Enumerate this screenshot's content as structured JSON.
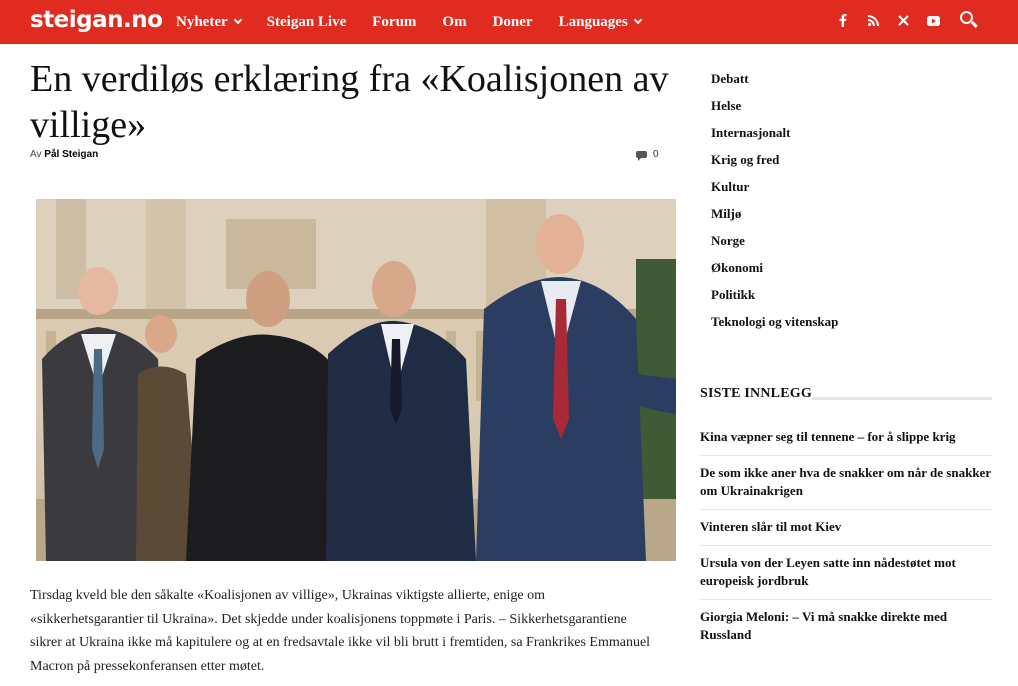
{
  "header": {
    "logo": "steigan.no",
    "nav": [
      {
        "label": "Nyheter",
        "dropdown": true
      },
      {
        "label": "Steigan Live",
        "dropdown": false
      },
      {
        "label": "Forum",
        "dropdown": false
      },
      {
        "label": "Om",
        "dropdown": false
      },
      {
        "label": "Doner",
        "dropdown": false
      },
      {
        "label": "Languages",
        "dropdown": true
      }
    ],
    "social_icons": [
      "facebook-icon",
      "rss-icon",
      "x-icon",
      "youtube-icon"
    ],
    "search_icon": "search-icon",
    "brand_color": "#e02b20"
  },
  "article": {
    "title": "En verdiløs erklæring fra «Koalisjonen av villige»",
    "byline_prefix": "Av",
    "author": "Pål Steigan",
    "comment_count": "0",
    "body": "Tirsdag kveld ble den såkalte «Koalisjonen av villige», Ukrainas viktigste allierte, enige om «sikkerhetsgarantier til Ukraina». Det skjedde under koalisjonens toppmøte i Paris. – Sikkerhetsgarantiene sikrer at Ukraina ikke må kapitulere og at en fredsavtale ikke vil bli brutt i fremtiden, sa Frankrikes Emmanuel Macron på pressekonferansen etter møtet."
  },
  "sidebar": {
    "categories": [
      "Debatt",
      "Helse",
      "Internasjonalt",
      "Krig og fred",
      "Kultur",
      "Miljø",
      "Norge",
      "Økonomi",
      "Politikk",
      "Teknologi og vitenskap"
    ],
    "recent_title": "SISTE INNLEGG",
    "recent_posts": [
      "Kina væpner seg til tennene – for å slippe krig",
      "De som ikke aner hva de snakker om når de snakker om Ukrainakrigen",
      "Vinteren slår til mot Kiev",
      "Ursula von der Leyen satte inn nådestøtet mot europeisk jordbruk",
      "Giorgia Meloni: – Vi må snakke direkte med Russland"
    ]
  }
}
